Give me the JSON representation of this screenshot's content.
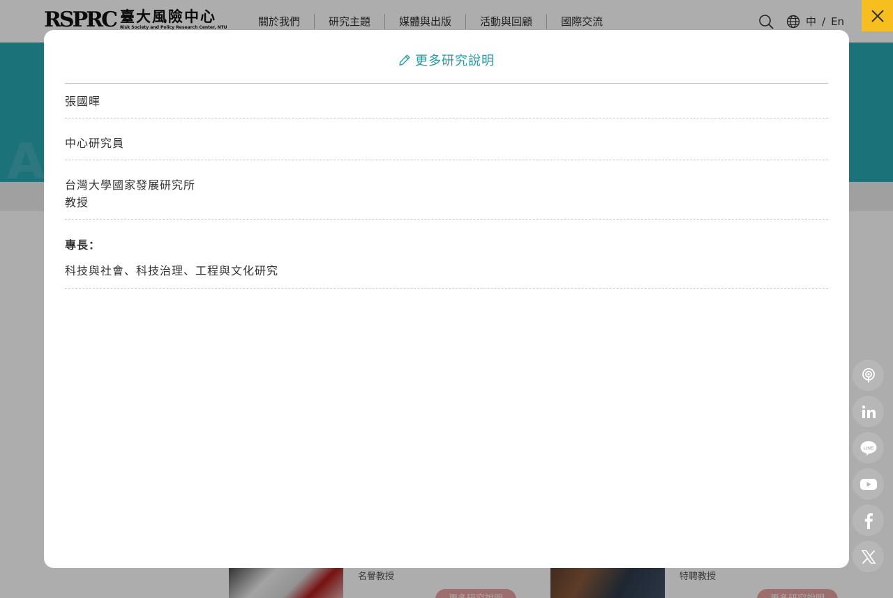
{
  "header": {
    "logo_mark": "RSPRC",
    "logo_cn": "臺大風險中心",
    "logo_en": "Risk Society and Policy Research Center, NTU",
    "nav": [
      "關於我們",
      "研究主題",
      "媒體與出版",
      "活動與回顧",
      "國際交流"
    ],
    "lang_zh": "中",
    "lang_sep": "/",
    "lang_en": "En"
  },
  "cards": [
    {
      "title": "名譽教授",
      "button": "更多研究說明"
    },
    {
      "title": "特聘教授",
      "button": "更多研究說明"
    }
  ],
  "social": [
    "podcast-icon",
    "linkedin-icon",
    "line-icon",
    "youtube-icon",
    "facebook-icon",
    "x-icon"
  ],
  "modal": {
    "title": "更多研究說明",
    "name": "張國暉",
    "position": "中心研究員",
    "affiliation_line1": "台灣大學國家發展研究所",
    "affiliation_line2": "教授",
    "specialty_label": "專長：",
    "specialty_value": "科技與社會、科技治理、工程與文化研究"
  },
  "colors": {
    "accent": "#1f9aa6",
    "hero": "#2aa8b3",
    "close_button": "#f6be1f"
  }
}
